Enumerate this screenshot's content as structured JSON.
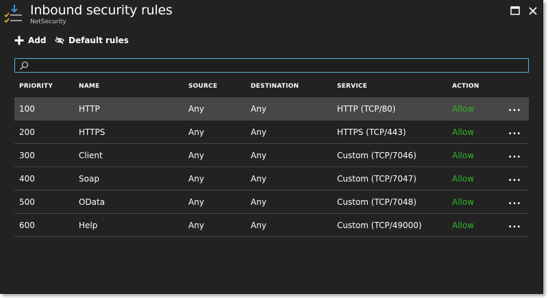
{
  "blade": {
    "title": "Inbound security rules",
    "subtitle": "NetSecurity"
  },
  "toolbar": {
    "add_label": "Add",
    "default_rules_label": "Default rules"
  },
  "search": {
    "value": "",
    "placeholder": ""
  },
  "grid": {
    "columns": [
      "PRIORITY",
      "NAME",
      "SOURCE",
      "DESTINATION",
      "SERVICE",
      "ACTION"
    ],
    "more_label": "...",
    "rows": [
      {
        "priority": "100",
        "name": "HTTP",
        "source": "Any",
        "destination": "Any",
        "service": "HTTP (TCP/80)",
        "action": "Allow"
      },
      {
        "priority": "200",
        "name": "HTTPS",
        "source": "Any",
        "destination": "Any",
        "service": "HTTPS (TCP/443)",
        "action": "Allow"
      },
      {
        "priority": "300",
        "name": "Client",
        "source": "Any",
        "destination": "Any",
        "service": "Custom (TCP/7046)",
        "action": "Allow"
      },
      {
        "priority": "400",
        "name": "Soap",
        "source": "Any",
        "destination": "Any",
        "service": "Custom (TCP/7047)",
        "action": "Allow"
      },
      {
        "priority": "500",
        "name": "OData",
        "source": "Any",
        "destination": "Any",
        "service": "Custom (TCP/7048)",
        "action": "Allow"
      },
      {
        "priority": "600",
        "name": "Help",
        "source": "Any",
        "destination": "Any",
        "service": "Custom (TCP/49000)",
        "action": "Allow"
      }
    ],
    "selected_row": 0
  },
  "colors": {
    "blade_background": "#222222",
    "selected_row": "#474747",
    "allow": "#2db92d",
    "search_border": "#59b4d9",
    "icon_blue": "#3a96dd",
    "icon_yellow": "#e8c32e"
  },
  "icons": {
    "header": "inbound-rules-icon",
    "maximize": "maximize-icon",
    "close": "close-icon",
    "add": "plus-icon",
    "default_rules": "eye-slash-icon",
    "search": "search-icon",
    "more": "ellipsis-icon"
  }
}
